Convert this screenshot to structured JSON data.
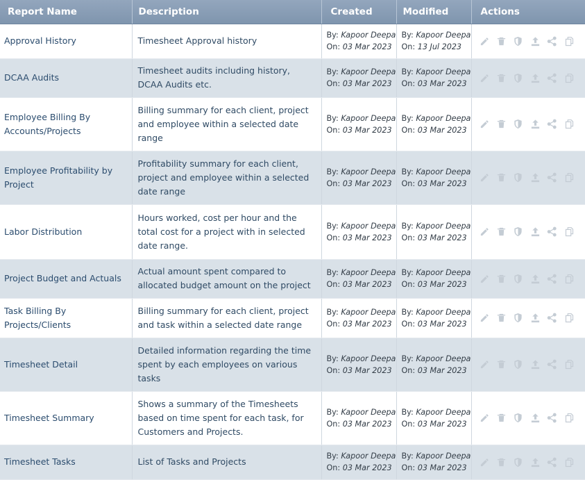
{
  "header": {
    "report_name": "Report Name",
    "description": "Description",
    "created": "Created",
    "modified": "Modified",
    "actions": "Actions"
  },
  "meta_labels": {
    "by": "By:",
    "on": "On:"
  },
  "action_icons": [
    "edit-icon",
    "trash-icon",
    "shield-icon",
    "upload-icon",
    "share-icon",
    "copy-icon"
  ],
  "icon_color": "#c4ccd4",
  "header_color": "#8a9db4",
  "stripe_color": "#d9e1e8",
  "rows": [
    {
      "name": "Approval History",
      "description": "Timesheet Approval history",
      "created_by": "Kapoor Deepa",
      "created_on": "03 Mar 2023",
      "modified_by": "Kapoor Deepa",
      "modified_on": "13 Jul 2023"
    },
    {
      "name": "DCAA Audits",
      "description": "Timesheet audits including history, DCAA Audits etc.",
      "created_by": "Kapoor Deepa",
      "created_on": "03 Mar 2023",
      "modified_by": "Kapoor Deepa",
      "modified_on": "03 Mar 2023"
    },
    {
      "name": "Employee Billing By Accounts/Projects",
      "description": "Billing summary for each client, project and employee within a selected date range",
      "created_by": "Kapoor Deepa",
      "created_on": "03 Mar 2023",
      "modified_by": "Kapoor Deepa",
      "modified_on": "03 Mar 2023"
    },
    {
      "name": "Employee Profitability by Project",
      "description": "Profitability summary for each client, project and employee within a selected date range",
      "created_by": "Kapoor Deepa",
      "created_on": "03 Mar 2023",
      "modified_by": "Kapoor Deepa",
      "modified_on": "03 Mar 2023"
    },
    {
      "name": "Labor Distribution",
      "description": "Hours worked, cost per hour and the total cost for a project with in selected date range.",
      "created_by": "Kapoor Deepa",
      "created_on": "03 Mar 2023",
      "modified_by": "Kapoor Deepa",
      "modified_on": "03 Mar 2023"
    },
    {
      "name": "Project Budget and Actuals",
      "description": "Actual amount spent compared to allocated budget amount on the project",
      "created_by": "Kapoor Deepa",
      "created_on": "03 Mar 2023",
      "modified_by": "Kapoor Deepa",
      "modified_on": "03 Mar 2023"
    },
    {
      "name": "Task Billing By Projects/Clients",
      "description": "Billing summary for each client, project and task within a selected date range",
      "created_by": "Kapoor Deepa",
      "created_on": "03 Mar 2023",
      "modified_by": "Kapoor Deepa",
      "modified_on": "03 Mar 2023"
    },
    {
      "name": "Timesheet Detail",
      "description": "Detailed information regarding the time spent by each employees on various tasks",
      "created_by": "Kapoor Deepa",
      "created_on": "03 Mar 2023",
      "modified_by": "Kapoor Deepa",
      "modified_on": "03 Mar 2023"
    },
    {
      "name": "Timesheet Summary",
      "description": "Shows a summary of the Timesheets based on time spent for each task, for Customers and Projects.",
      "created_by": "Kapoor Deepa",
      "created_on": "03 Mar 2023",
      "modified_by": "Kapoor Deepa",
      "modified_on": "03 Mar 2023"
    },
    {
      "name": "Timesheet Tasks",
      "description": "List of Tasks and Projects",
      "created_by": "Kapoor Deepa",
      "created_on": "03 Mar 2023",
      "modified_by": "Kapoor Deepa",
      "modified_on": "03 Mar 2023"
    }
  ]
}
